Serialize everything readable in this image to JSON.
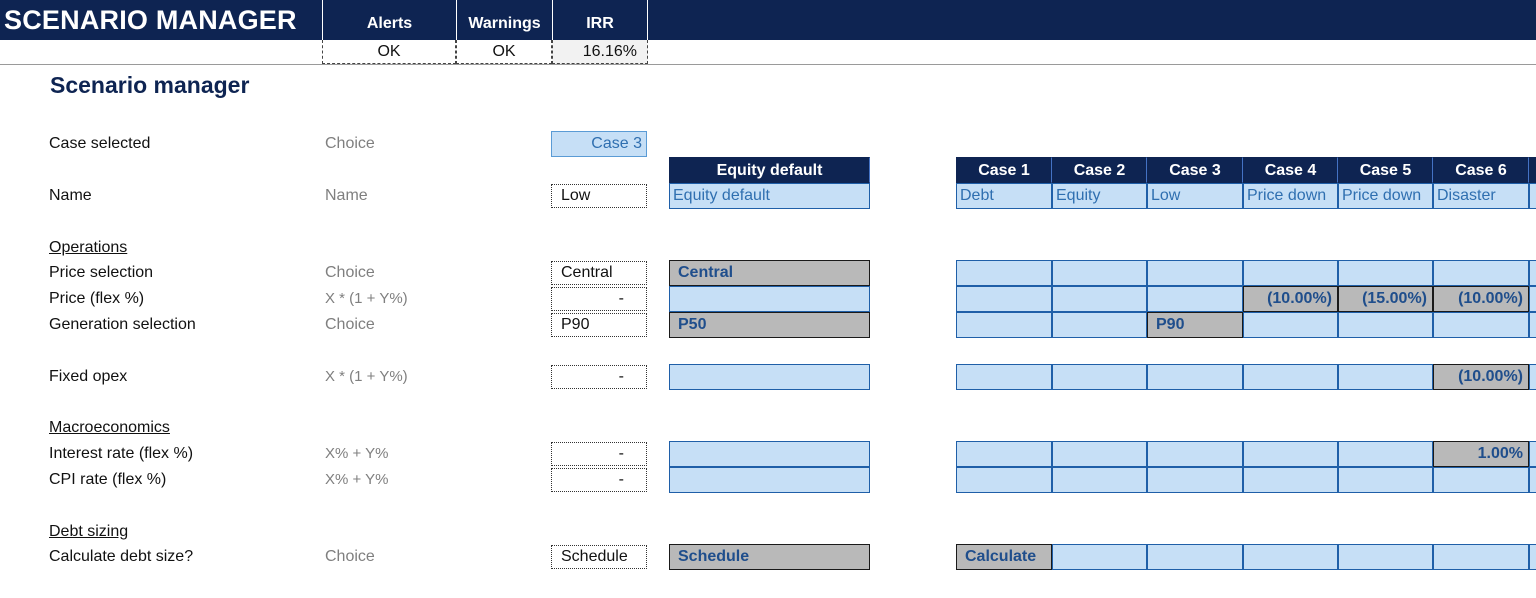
{
  "header": {
    "app_title": "SCENARIO MANAGER",
    "columns": [
      {
        "label": "Alerts",
        "value": "OK"
      },
      {
        "label": "Warnings",
        "value": "OK"
      },
      {
        "label": "IRR",
        "value": "16.16%"
      }
    ]
  },
  "page_title": "Scenario manager",
  "case_selected": {
    "label": "Case selected",
    "type": "Choice",
    "value": "Case 3"
  },
  "equity_default": {
    "header": "Equity default",
    "name": "Equity default"
  },
  "cases": [
    {
      "header": "Case 1",
      "name": "Debt"
    },
    {
      "header": "Case 2",
      "name": "Equity"
    },
    {
      "header": "Case 3",
      "name": "Low"
    },
    {
      "header": "Case 4",
      "name": "Price down"
    },
    {
      "header": "Case 5",
      "name": "Price down"
    },
    {
      "header": "Case 6",
      "name": "Disaster"
    }
  ],
  "rows": {
    "name": {
      "label": "Name",
      "type": "Name",
      "value": "Low"
    },
    "operations": "Operations",
    "price_selection": {
      "label": "Price selection",
      "type": "Choice",
      "value": "Central",
      "default": "Central"
    },
    "price_flex": {
      "label": "Price (flex %)",
      "type": "X * (1 + Y%)",
      "value": "-",
      "case4": "(10.00%)",
      "case5": "(15.00%)",
      "case6": "(10.00%)"
    },
    "generation_selection": {
      "label": "Generation selection",
      "type": "Choice",
      "value": "P90",
      "default": "P50",
      "case3": "P90"
    },
    "fixed_opex": {
      "label": "Fixed opex",
      "type": "X * (1 + Y%)",
      "value": "-",
      "case6": "(10.00%)"
    },
    "macroeconomics": "Macroeconomics",
    "interest_rate": {
      "label": "Interest rate (flex %)",
      "type": "X% + Y%",
      "value": "-",
      "case6": "1.00%"
    },
    "cpi_rate": {
      "label": "CPI rate (flex %)",
      "type": "X% + Y%",
      "value": "-"
    },
    "debt_sizing": "Debt sizing",
    "calc_debt": {
      "label": "Calculate debt size?",
      "type": "Choice",
      "value": "Schedule",
      "default": "Schedule",
      "case1": "Calculate"
    }
  }
}
